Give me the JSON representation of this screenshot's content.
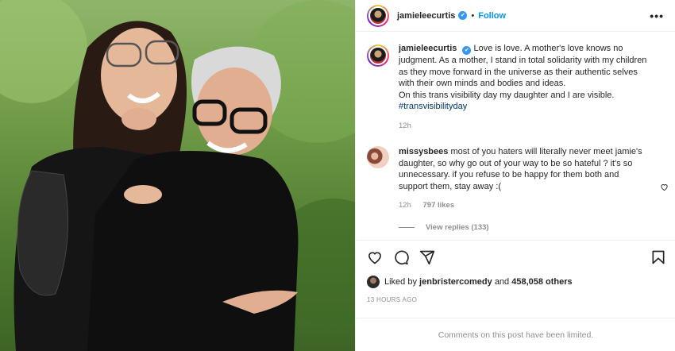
{
  "post": {
    "author": "jamieleecurtis",
    "follow_label": "Follow",
    "separator": "•",
    "more_label": "•••"
  },
  "caption": {
    "username": "jamieleecurtis",
    "text": "Love is love. A mother's love knows no judgment. As a mother, I stand in total solidarity with my children as they move forward in the universe as their authentic selves with their own minds and bodies and ideas.",
    "text2": "On this trans visibility day my daughter and I are visible.",
    "hashtag": "#transvisibilityday",
    "time": "12h"
  },
  "comment": {
    "username": "missysbees",
    "text": "most of you haters will literally never meet jamie's daughter, so why go out of your way to be so hateful ? it's so unnecessary. if you refuse to be happy for them both and support them, stay away :(",
    "time": "12h",
    "likes": "797 likes",
    "view_replies": "View replies (133)"
  },
  "likes": {
    "prefix": "Liked by ",
    "user": "jenbristercomedy",
    "middle": " and ",
    "count": "458,058 others"
  },
  "timestamp": "13 HOURS AGO",
  "comments_limited": "Comments on this post have been limited.",
  "colors": {
    "link": "#0095f6",
    "verified": "#3897f0",
    "muted": "#8e8e8e"
  },
  "icons": [
    "verified-icon",
    "more-icon",
    "heart-icon",
    "comment-icon",
    "share-icon",
    "save-icon"
  ]
}
